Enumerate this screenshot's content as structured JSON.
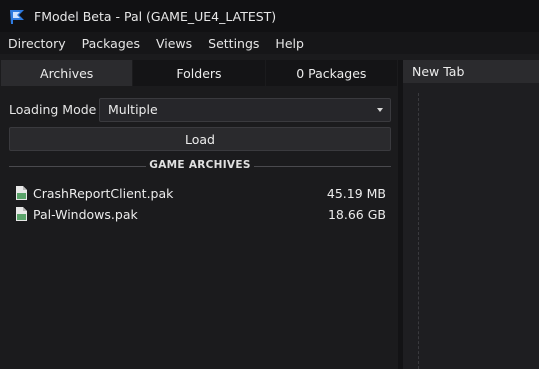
{
  "window": {
    "title": "FModel Beta - Pal (GAME_UE4_LATEST)"
  },
  "menu": {
    "items": [
      "Directory",
      "Packages",
      "Views",
      "Settings",
      "Help"
    ]
  },
  "tabs": [
    {
      "label": "Archives",
      "active": true
    },
    {
      "label": "Folders",
      "active": false
    },
    {
      "label": "0 Packages",
      "active": false
    }
  ],
  "loading_mode": {
    "label": "Loading Mode",
    "value": "Multiple"
  },
  "load_button": {
    "label": "Load"
  },
  "archives_section": {
    "title": "GAME ARCHIVES"
  },
  "archives": [
    {
      "name": "CrashReportClient.pak",
      "size": "45.19 MB"
    },
    {
      "name": "Pal-Windows.pak",
      "size": "18.66 GB"
    }
  ],
  "document_tab": {
    "label": "New Tab"
  },
  "colors": {
    "accent": "#2f7be0",
    "file_icon": "#5aa36a"
  }
}
